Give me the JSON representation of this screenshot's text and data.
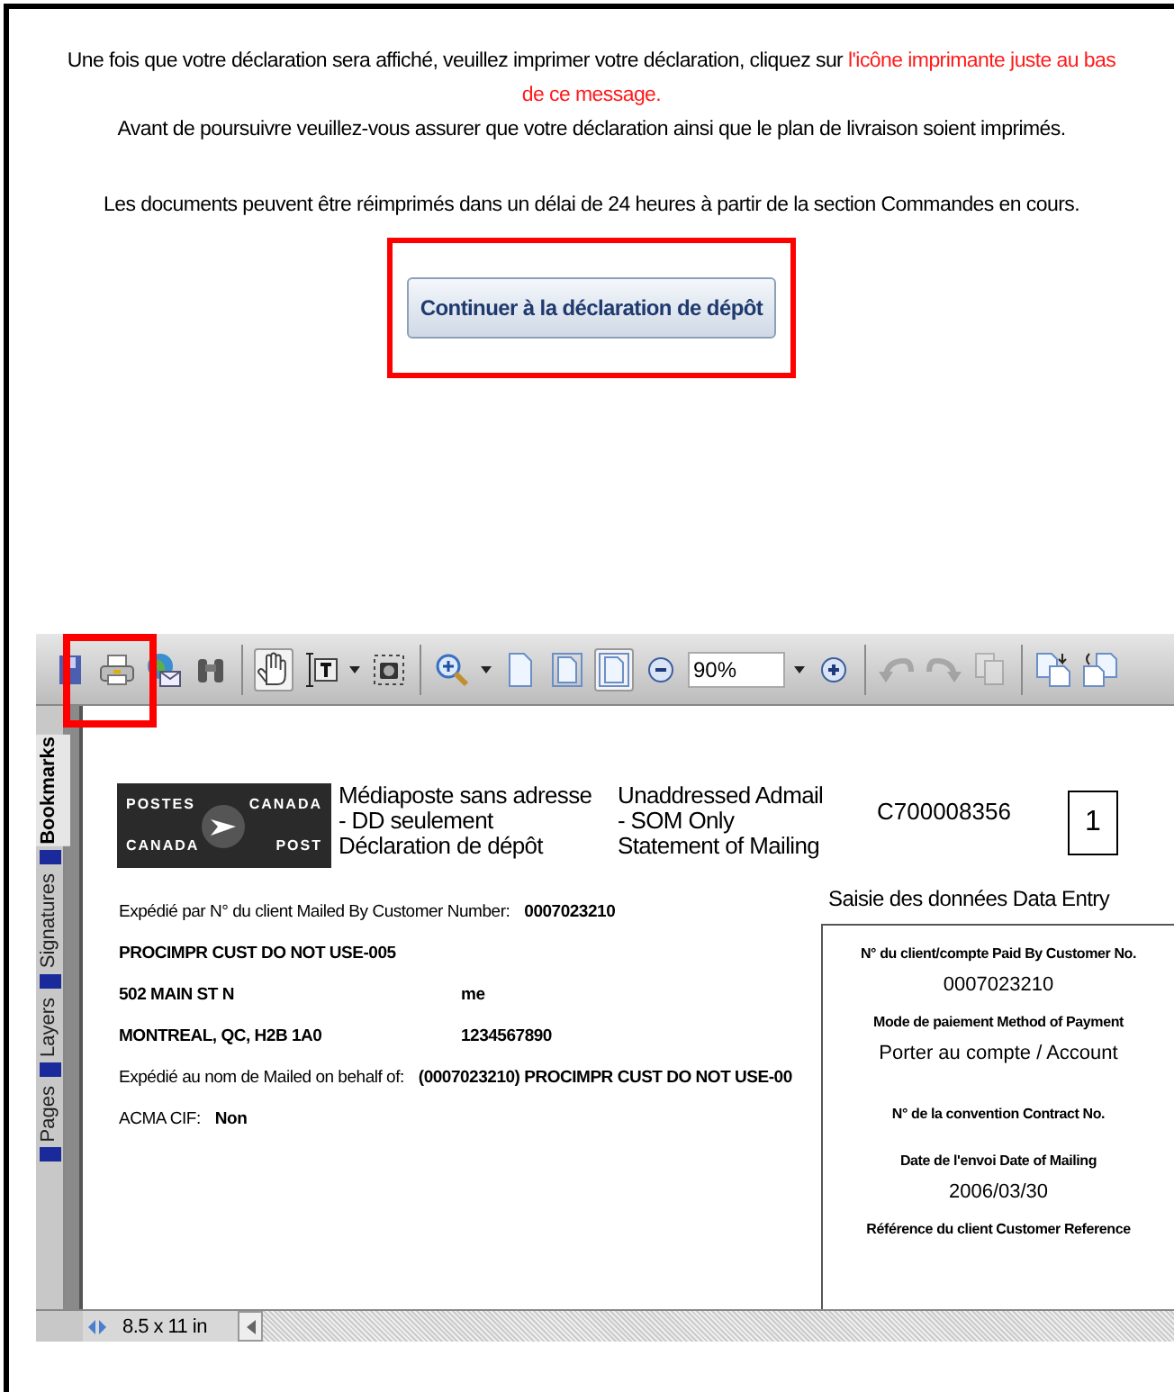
{
  "notice": {
    "message": "Une fois que votre déclaration sera affiché, veuillez imprimer votre déclaration, cliquez sur ",
    "message_highlight": "l'icône imprimante juste au bas de ce message.",
    "reminder": "Avant de poursuivre veuillez-vous assurer que votre déclaration ainsi que le plan de livraison soient imprimés.",
    "reprint_note": "Les documents peuvent être réimprimés dans un délai de 24 heures à partir de la section Commandes en cours."
  },
  "continue_button": {
    "label": "Continuer à la déclaration de dépôt",
    "highlighted": true
  },
  "viewer": {
    "toolbar": {
      "print": {
        "highlighted": true
      },
      "hand_tool": {
        "selected": true
      },
      "fit_width": {
        "selected": true
      },
      "zoom_level": "90%",
      "rotate_left": {
        "disabled": true
      },
      "rotate_right": {
        "disabled": true
      },
      "copy": {
        "disabled": true
      }
    },
    "side_tabs": [
      {
        "label": "Bookmarks",
        "selected": true
      },
      {
        "label": "Signatures",
        "selected": false
      },
      {
        "label": "Layers",
        "selected": false
      },
      {
        "label": "Pages",
        "selected": false
      }
    ],
    "document": {
      "logo": [
        "POSTES",
        "CANADA",
        "CANADA",
        "POST"
      ],
      "title_fr": [
        "Médiaposte sans adresse",
        "- DD seulement",
        "Déclaration de dépôt"
      ],
      "title_en": [
        "Unaddressed Admail",
        "- SOM Only",
        "Statement of Mailing"
      ],
      "number": "C700008356",
      "page": "1",
      "sender_rows": [
        {
          "label": "Expédié par N° du client  Mailed By Customer Number:",
          "value": "0007023210"
        },
        {
          "label": "PROCIMPR CUST DO NOT USE-005"
        },
        {
          "label": "502 MAIN ST N",
          "value": "me"
        },
        {
          "label": "MONTREAL, QC, H2B 1A0",
          "value": "1234567890"
        },
        {
          "label": "Expédié au nom de  Mailed on behalf of:",
          "value": "(0007023210) PROCIMPR CUST DO NOT USE-00"
        },
        {
          "label": "ACMA  CIF:",
          "value": "Non"
        }
      ],
      "data_entry": {
        "heading": "Saisie des données   Data Entry",
        "fields": [
          {
            "label": "N° du client/compte  Paid By Customer No.",
            "value": "0007023210"
          },
          {
            "label": "Mode de paiement  Method of Payment",
            "value": "Porter au compte / Account"
          },
          {
            "label": "N° de la convention  Contract No."
          },
          {
            "label": "Date de l'envoi  Date of Mailing",
            "value": "2006/03/30"
          },
          {
            "label": "Référence du client  Customer Reference"
          }
        ]
      }
    },
    "page_size": "8.5 x 11 in"
  }
}
